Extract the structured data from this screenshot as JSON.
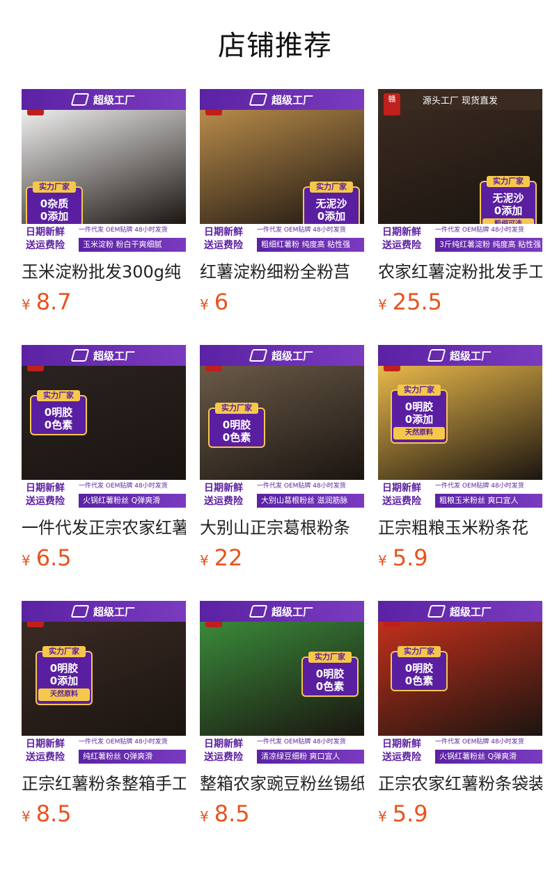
{
  "page": {
    "title": "店铺推荐"
  },
  "products": [
    {
      "banner": "超级工厂",
      "badge": {
        "top": "实力厂家",
        "lines": [
          "0杂质",
          "0添加"
        ],
        "sub": ""
      },
      "tags": [
        "日期新鲜",
        "送运费险"
      ],
      "ribbon": "一件代发 OEM贴牌 48小时发货",
      "slogan": "玉米淀粉 粉白干爽细腻",
      "name": "玉米淀粉批发300g纯",
      "price": "8.7",
      "bg": "#eeeeee"
    },
    {
      "banner": "超级工厂",
      "badge": {
        "top": "实力厂家",
        "lines": [
          "无泥沙",
          "0添加"
        ],
        "sub": "粗细可选"
      },
      "tags": [
        "日期新鲜",
        "送运费险"
      ],
      "ribbon": "一件代发 OEM贴牌 48小时发货",
      "slogan": "粗细红薯粉 纯度高 粘性强",
      "name": "红薯淀粉细粉全粉莒",
      "price": "6",
      "bg": "#b88b4a"
    },
    {
      "banner": "源头工厂 现货直发",
      "badge": {
        "top": "实力厂家",
        "lines": [
          "无泥沙",
          "0添加"
        ],
        "sub": "粗细可选"
      },
      "tags": [
        "日期新鲜",
        "送运费险"
      ],
      "ribbon": "一件代发 OEM贴牌 48小时发货",
      "slogan": "3斤纯红薯淀粉 纯度高 粘性强",
      "name": "农家红薯淀粉批发手工",
      "price": "25.5",
      "bg": "#3a2a20"
    },
    {
      "banner": "超级工厂",
      "badge": {
        "top": "实力厂家",
        "lines": [
          "0明胶",
          "0色素"
        ],
        "sub": ""
      },
      "tags": [
        "日期新鲜",
        "送运费险"
      ],
      "ribbon": "一件代发 OEM贴牌 48小时发货",
      "slogan": "火锅红薯粉丝 Q弹爽滑",
      "name": "一件代发正宗农家红薯",
      "price": "6.5",
      "bg": "#2a2320"
    },
    {
      "banner": "超级工厂",
      "badge": {
        "top": "实力厂家",
        "lines": [
          "0明胶",
          "0色素"
        ],
        "sub": ""
      },
      "tags": [
        "日期新鲜",
        "送运费险"
      ],
      "ribbon": "一件代发 OEM贴牌 48小时发货",
      "slogan": "大别山葛根粉丝 滋润筋脉",
      "name": "大别山正宗葛根粉条",
      "price": "22",
      "bg": "#6a5a48"
    },
    {
      "banner": "超级工厂",
      "badge": {
        "top": "实力厂家",
        "lines": [
          "0明胶",
          "0添加"
        ],
        "sub": "天然原料"
      },
      "tags": [
        "日期新鲜",
        "送运费险"
      ],
      "ribbon": "一件代发 OEM贴牌 48小时发货",
      "slogan": "粗粮玉米粉丝 爽口宜人",
      "name": "正宗粗粮玉米粉条花",
      "price": "5.9",
      "bg": "#e8b84a"
    },
    {
      "banner": "超级工厂",
      "badge": {
        "top": "实力厂家",
        "lines": [
          "0明胶",
          "0添加"
        ],
        "sub": "天然原料"
      },
      "tags": [
        "日期新鲜",
        "送运费险"
      ],
      "ribbon": "一件代发 OEM贴牌 48小时发货",
      "slogan": "纯红薯粉丝 Q弹爽滑",
      "name": "正宗红薯粉条整箱手工",
      "price": "8.5",
      "bg": "#3a2a24"
    },
    {
      "banner": "超级工厂",
      "badge": {
        "top": "实力厂家",
        "lines": [
          "0明胶",
          "0色素"
        ],
        "sub": ""
      },
      "tags": [
        "日期新鲜",
        "送运费险"
      ],
      "ribbon": "一件代发 OEM贴牌 48小时发货",
      "slogan": "清凉绿豆细粉 爽口宜人",
      "name": "整箱农家豌豆粉丝锡纸",
      "price": "8.5",
      "bg": "#3a8a3a"
    },
    {
      "banner": "超级工厂",
      "badge": {
        "top": "实力厂家",
        "lines": [
          "0明胶",
          "0色素"
        ],
        "sub": ""
      },
      "tags": [
        "日期新鲜",
        "送运费险"
      ],
      "ribbon": "一件代发 OEM贴牌 48小时发货",
      "slogan": "火锅红薯粉丝 Q弹爽滑",
      "name": "正宗农家红薯粉条袋装",
      "price": "5.9",
      "bg": "#c0301c"
    }
  ],
  "currency_symbol": "¥",
  "colors": {
    "price": "#e8531e",
    "brand_purple": "#5a1fa0",
    "badge_gold": "#f5c84c"
  }
}
